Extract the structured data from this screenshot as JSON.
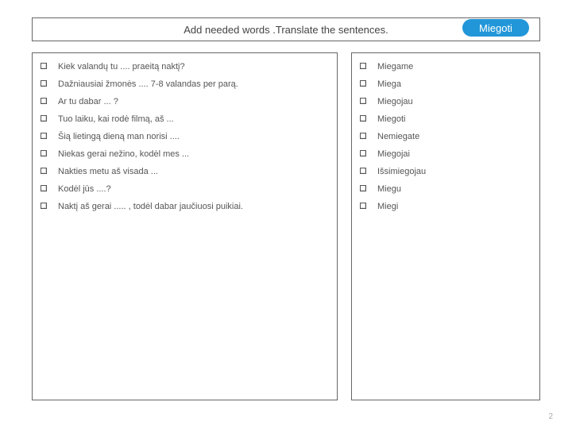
{
  "header": {
    "title": "Add needed words .Translate the sentences."
  },
  "badge": {
    "label": "Miegoti"
  },
  "left": {
    "items": [
      "Kiek valandų tu .... praeitą naktį?",
      "Dažniausiai žmonės .... 7-8 valandas per parą.",
      "Ar tu dabar ... ?",
      "Tuo laiku, kai rodė filmą, aš ...",
      "Šią lietingą dieną man norisi ....",
      "Niekas gerai nežino, kodėl mes ...",
      "Nakties metu aš visada ...",
      "Kodėl jūs ....?",
      "Naktį aš gerai .....  , todėl dabar jaučiuosi puikiai."
    ]
  },
  "right": {
    "items": [
      "Miegame",
      "Miega",
      "Miegojau",
      "Miegoti",
      "Nemiegate",
      "Miegojai",
      "Išsimiegojau",
      "Miegu",
      "Miegi"
    ]
  },
  "page": {
    "number": "2"
  }
}
